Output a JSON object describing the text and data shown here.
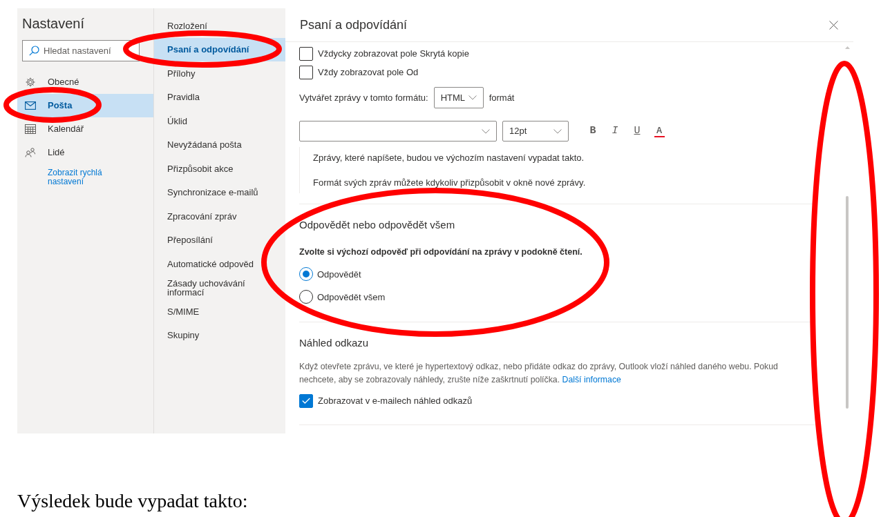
{
  "settings_sidebar": {
    "title": "Nastavení",
    "search": {
      "placeholder": "Hledat nastavení"
    },
    "items": [
      {
        "label": "Obecné",
        "selected": false
      },
      {
        "label": "Pošta",
        "selected": true
      },
      {
        "label": "Kalendář",
        "selected": false
      },
      {
        "label": "Lidé",
        "selected": false
      }
    ],
    "quick_settings_link": "Zobrazit rychlá nastavení"
  },
  "mail_menu": {
    "items": [
      {
        "label": "Rozložení",
        "selected": false
      },
      {
        "label": "Psaní a odpovídání",
        "selected": true
      },
      {
        "label": "Přílohy",
        "selected": false
      },
      {
        "label": "Pravidla",
        "selected": false
      },
      {
        "label": "Úklid",
        "selected": false
      },
      {
        "label": "Nevyžádaná pošta",
        "selected": false
      },
      {
        "label": "Přizpůsobit akce",
        "selected": false
      },
      {
        "label": "Synchronizace e-mailů",
        "selected": false
      },
      {
        "label": "Zpracování zpráv",
        "selected": false
      },
      {
        "label": "Přeposílání",
        "selected": false
      },
      {
        "label": "Automatické odpověd",
        "selected": false
      },
      {
        "label": "Zásady uchovávání informací",
        "selected": false
      },
      {
        "label": "S/MIME",
        "selected": false
      },
      {
        "label": "Skupiny",
        "selected": false
      }
    ]
  },
  "panel": {
    "title": "Psaní a odpovídání",
    "options": [
      {
        "label": "Vždycky zobrazovat pole Skrytá kopie",
        "checked": false
      },
      {
        "label": "Vždy zobrazovat pole Od",
        "checked": false
      }
    ],
    "format_row": {
      "label": "Vytvářet zprávy v tomto formátu:",
      "value": "HTML",
      "suffix": "formát"
    },
    "font_size": "12pt",
    "toolbar": [
      {
        "kind": "bold",
        "label": "B"
      },
      {
        "kind": "italic",
        "label": "I"
      },
      {
        "kind": "underline",
        "label": "U"
      },
      {
        "kind": "color",
        "label": "A",
        "color": "#e81123"
      }
    ],
    "preview_lines": [
      "Zprávy, které napíšete, budou ve výchozím nastavení vypadat takto.",
      "Formát svých zpráv můžete kdykoliv přizpůsobit v okně nové zprávy."
    ],
    "reply_section": {
      "heading": "Odpovědět nebo odpovědět všem",
      "prompt": "Zvolte si výchozí odpověď při odpovídání na zprávy v podokně čtení.",
      "choices": [
        {
          "label": "Odpovědět",
          "selected": true
        },
        {
          "label": "Odpovědět všem",
          "selected": false
        }
      ]
    },
    "link_preview": {
      "heading": "Náhled odkazu",
      "text": "Když otevřete zprávu, ve které je hypertextový odkaz, nebo přidáte odkaz do zprávy, Outlook vloží náhled daného webu. Pokud nechcete, aby se zobrazovaly náhledy, zrušte níže zaškrtnutí políčka.",
      "link": "Další informace",
      "option": {
        "label": "Zobrazovat v e-mailech náhled odkazů",
        "checked": true
      }
    }
  },
  "document_caption": "Výsledek bude vypadat takto:"
}
